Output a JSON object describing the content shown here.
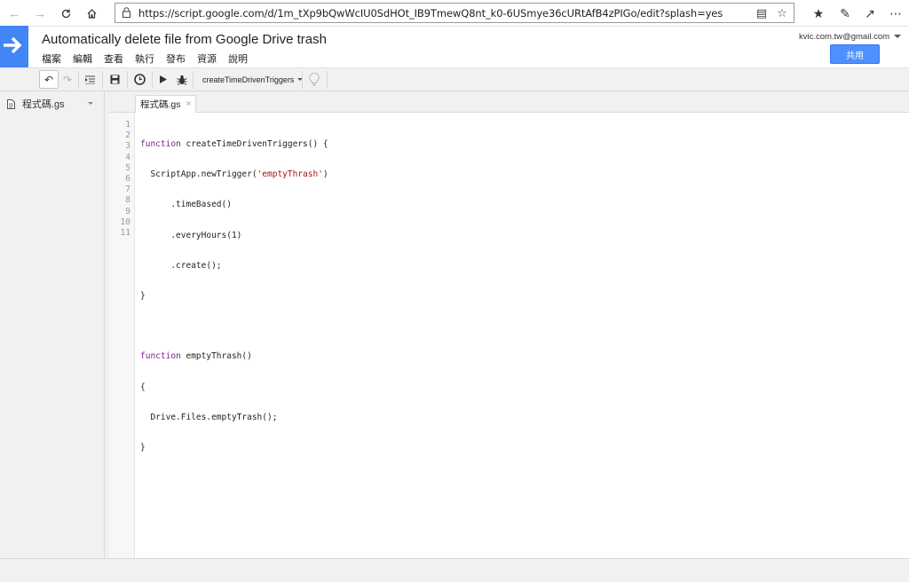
{
  "browser": {
    "url": "https://script.google.com/d/1m_tXp9bQwWcIU0SdHOt_IB9TmewQ8nt_k0-6USmye36cURtAfB4zPIGo/edit?splash=yes"
  },
  "app": {
    "title": "Automatically delete file from Google Drive trash",
    "account": "kvic.com.tw@gmail.com",
    "share_label": "共用",
    "brand_color": "#4285f4",
    "menus": [
      "檔案",
      "編輯",
      "查看",
      "執行",
      "發布",
      "資源",
      "說明"
    ]
  },
  "toolbar": {
    "function_select": "createTimeDrivenTriggers"
  },
  "files": {
    "items": [
      {
        "label": "程式碼.gs"
      }
    ]
  },
  "editor": {
    "tab_label": "程式碼.gs",
    "line_numbers": [
      "1",
      "2",
      "3",
      "4",
      "5",
      "6",
      "7",
      "8",
      "9",
      "10",
      "11"
    ],
    "code": [
      "function createTimeDrivenTriggers() {",
      "  ScriptApp.newTrigger('emptyThrash')",
      "      .timeBased()",
      "      .everyHours(1)",
      "      .create();",
      "}",
      "",
      "function emptyThrash()",
      "{",
      "  Drive.Files.emptyTrash();",
      "}"
    ]
  }
}
